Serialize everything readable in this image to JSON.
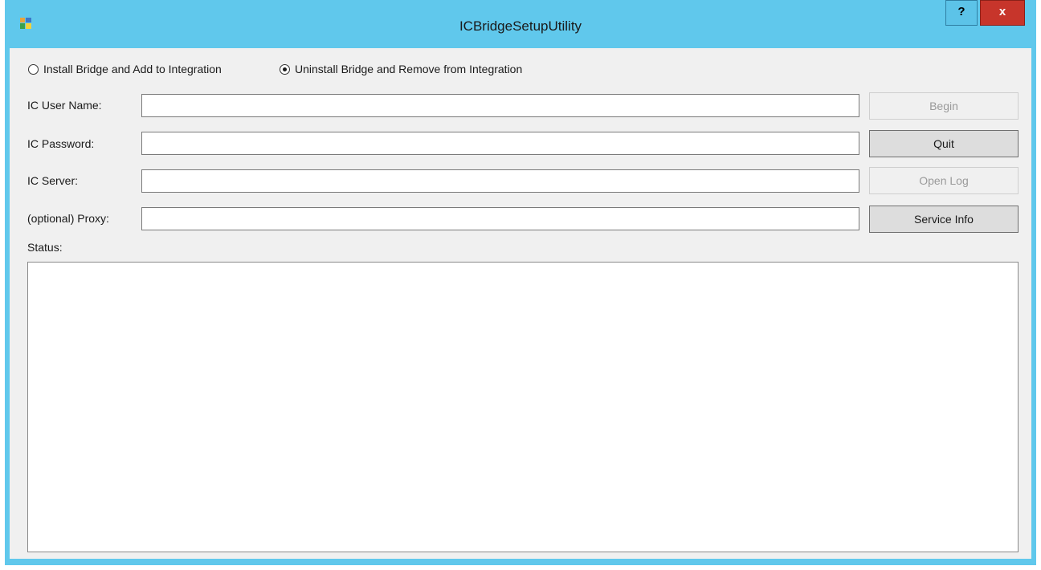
{
  "window": {
    "title": "ICBridgeSetupUtility",
    "help_label": "?",
    "close_label": "x"
  },
  "mode": {
    "options": [
      {
        "label": "Install Bridge and Add to Integration",
        "selected": false
      },
      {
        "label": "Uninstall Bridge and Remove from Integration",
        "selected": true
      }
    ]
  },
  "form": {
    "user_name_label": "IC User Name:",
    "user_name_value": "",
    "password_label": "IC Password:",
    "password_value": "",
    "server_label": "IC Server:",
    "server_value": "",
    "proxy_label": "(optional) Proxy:",
    "proxy_value": "",
    "status_label": "Status:",
    "status_text": ""
  },
  "buttons": {
    "begin": {
      "label": "Begin",
      "enabled": false
    },
    "quit": {
      "label": "Quit",
      "enabled": true
    },
    "open_log": {
      "label": "Open Log",
      "enabled": false
    },
    "service_info": {
      "label": "Service Info",
      "enabled": true
    }
  },
  "colors": {
    "titlebar": "#60c8ec",
    "client": "#f0f0f0",
    "close_button": "#c7352b"
  }
}
